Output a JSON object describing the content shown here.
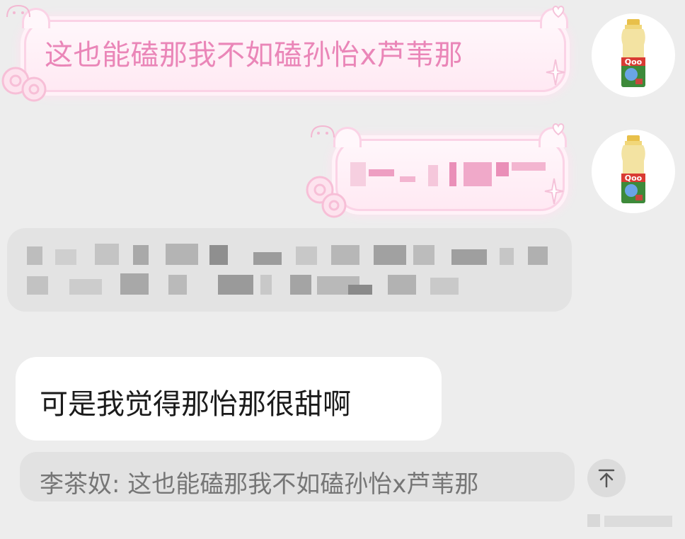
{
  "messages": {
    "pink_bubble_1": "这也能磕那我不如磕孙怡x芦苇那",
    "white_bubble": "可是我觉得那怡那很甜啊"
  },
  "quote": {
    "text": "李茶奴: 这也能磕那我不如磕孙怡x芦苇那"
  },
  "avatar": {
    "brand_text": "Qoo"
  },
  "colors": {
    "background": "#ededed",
    "pink_text": "#ea86b8",
    "pink_border": "#fbd3e6",
    "blurred_bubble": "#e3e3e3",
    "quote_text": "#767676"
  },
  "icons": {
    "scroll_top": "arrow-up-to-line-icon",
    "avatar": "qoo-bottle-avatar"
  }
}
